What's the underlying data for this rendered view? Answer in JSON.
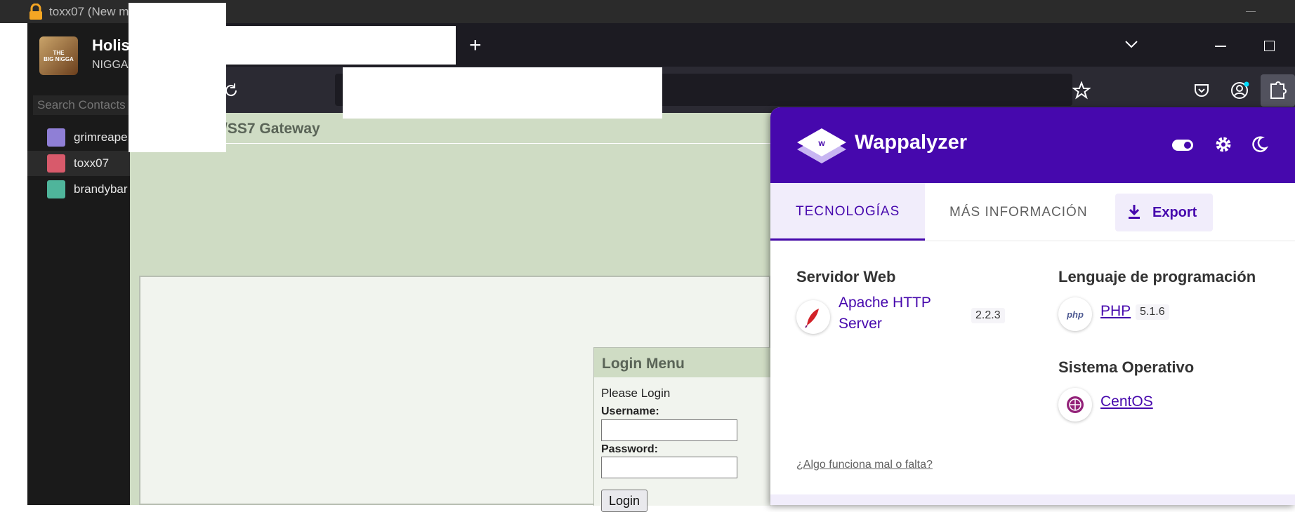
{
  "chat": {
    "window_title": "toxx07 (New m",
    "profile_name": "Holis",
    "profile_status": "NIGGA",
    "logo_line1": "THE",
    "logo_line2": "BIG NIGGA",
    "search_placeholder": "Search Contacts",
    "contacts": [
      "grimreape",
      "toxx07",
      "brandybar"
    ]
  },
  "browser": {
    "new_tab": "+",
    "page": {
      "header_title": "/SS7 Gateway",
      "login_title": "Login Menu",
      "please_login": "Please Login",
      "username_label": "Username:",
      "password_label": "Password:",
      "login_button": "Login"
    }
  },
  "wappalyzer": {
    "brand": "Wappalyzer",
    "tab_technologies": "TECNOLOGÍAS",
    "tab_more_info": "MÁS INFORMACIÓN",
    "export_label": "Export",
    "categories": [
      {
        "name": "Servidor Web",
        "techs": [
          {
            "name_line1": "Apache HTTP",
            "name_line2": "Server",
            "version": "2.2.3"
          }
        ]
      },
      {
        "name": "Lenguaje de programación",
        "techs": [
          {
            "name": "PHP",
            "version": "5.1.6",
            "icon_text": "php"
          }
        ]
      },
      {
        "name": "Sistema Operativo",
        "techs": [
          {
            "name": "CentOS"
          }
        ]
      }
    ],
    "feedback": "¿Algo funciona mal o falta?"
  },
  "colors": {
    "wappalyzer_purple": "#4608ad",
    "page_green": "#cfdcc4",
    "dark": "#1c1b22"
  }
}
